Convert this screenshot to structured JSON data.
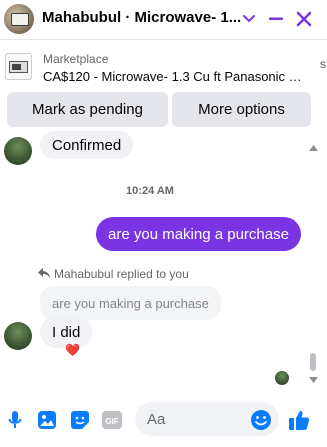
{
  "colors": {
    "accent": "#7b34e3",
    "messenger_blue": "#0a7cff",
    "bubble_incoming": "#f0f2f5",
    "secondary_text": "#65676b",
    "reaction": "#e41e3f"
  },
  "header": {
    "title": "Mahabubul · Microwave- 1...",
    "icons": [
      "chevron-down-icon",
      "minimize-icon",
      "close-icon"
    ]
  },
  "listing": {
    "kicker": "Marketplace",
    "title": "CA$120 - Microwave- 1.3 Cu ft Panasonic N...",
    "edge_glyph": "s"
  },
  "actions": {
    "mark_pending": "Mark as pending",
    "more_options": "More options"
  },
  "messages": {
    "confirmed": "Confirmed",
    "timestamp": "10:24 AM",
    "outgoing_question": "are you making a purchase",
    "reply_note": "Mahabubul replied to you",
    "quoted": "are you making a purchase",
    "reply": "I did",
    "reaction": "❤️"
  },
  "composer": {
    "placeholder": "Aa",
    "icons": [
      "microphone-icon",
      "image-icon",
      "sticker-icon",
      "gif-icon",
      "emoji-icon",
      "like-icon"
    ]
  }
}
